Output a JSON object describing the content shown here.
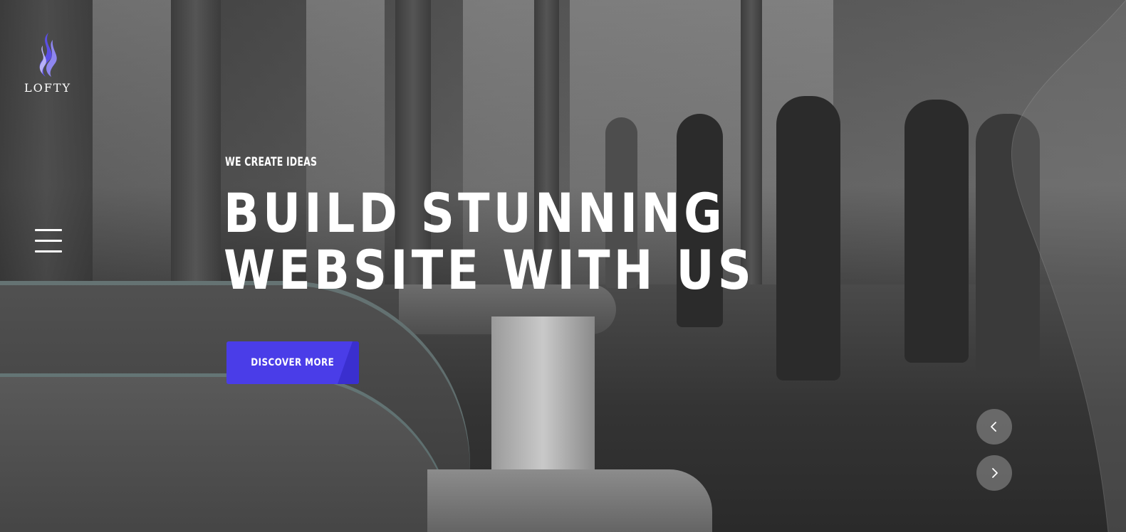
{
  "brand": {
    "name": "LOFTY",
    "accent_color": "#4a3de8",
    "logo_icon": "flame-icon"
  },
  "nav": {
    "menu_icon": "hamburger-icon"
  },
  "hero": {
    "eyebrow": "WE CREATE IDEAS",
    "headline": "BUILD STUNNING WEBSITE WITH US",
    "cta_label": "DISCOVER MORE"
  },
  "slider": {
    "prev_icon": "chevron-left-icon",
    "next_icon": "chevron-right-icon"
  }
}
